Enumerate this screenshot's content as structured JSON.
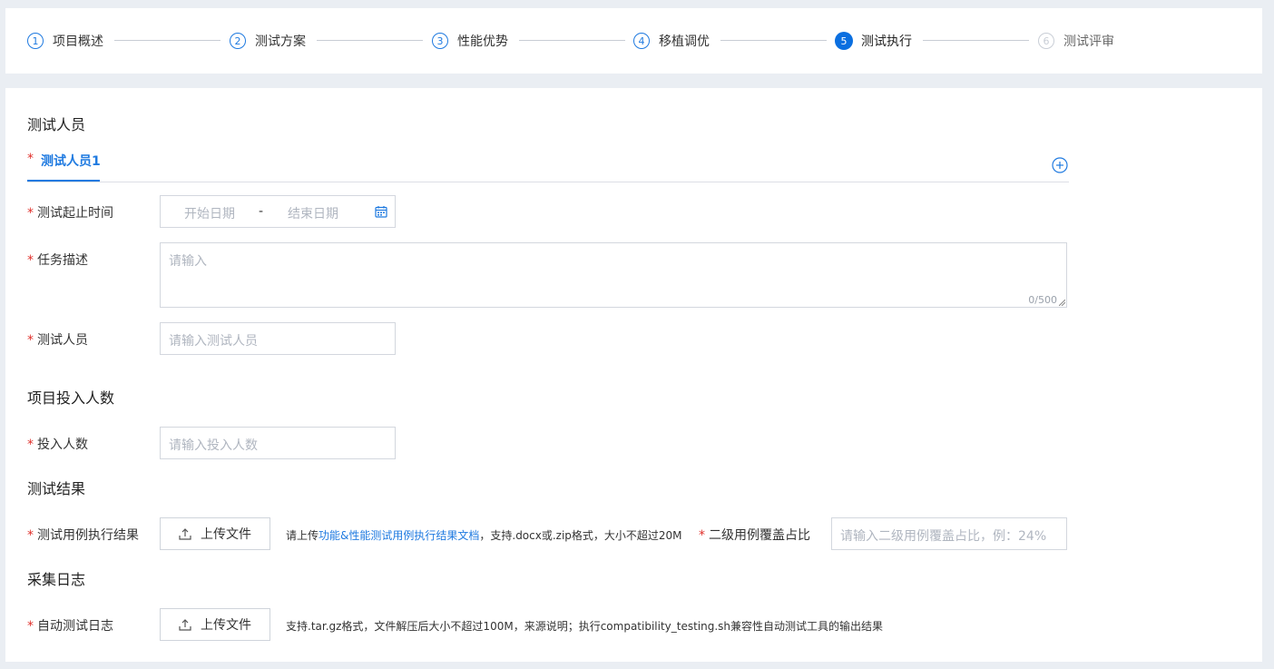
{
  "steps": [
    {
      "num": "1",
      "label": "项目概述",
      "state": "done"
    },
    {
      "num": "2",
      "label": "测试方案",
      "state": "done"
    },
    {
      "num": "3",
      "label": "性能优势",
      "state": "done"
    },
    {
      "num": "4",
      "label": "移植调优",
      "state": "done"
    },
    {
      "num": "5",
      "label": "测试执行",
      "state": "active"
    },
    {
      "num": "6",
      "label": "测试评审",
      "state": "pending"
    }
  ],
  "testers_section": {
    "title": "测试人员",
    "tab_label": "测试人员1",
    "add_icon": "plus-circle-icon",
    "period": {
      "label": "测试起止时间",
      "start_placeholder": "开始日期",
      "separator": "-",
      "end_placeholder": "结束日期",
      "icon": "calendar-icon"
    },
    "task": {
      "label": "任务描述",
      "placeholder": "请输入",
      "counter": "0/500"
    },
    "tester": {
      "label": "测试人员",
      "placeholder": "请输入测试人员"
    }
  },
  "investment_section": {
    "title": "项目投入人数",
    "label": "投入人数",
    "placeholder": "请输入投入人数"
  },
  "results_section": {
    "title": "测试结果",
    "label": "测试用例执行结果",
    "upload_label": "上传文件",
    "hint_prefix": "请上传",
    "hint_link": "功能&性能测试用例执行结果文档",
    "hint_suffix": "，支持.docx或.zip格式，大小不超过20M",
    "coverage_label": "二级用例覆盖占比",
    "coverage_placeholder": "请输入二级用例覆盖占比，例：24%"
  },
  "logs_section": {
    "title": "采集日志",
    "label": "自动测试日志",
    "upload_label": "上传文件",
    "hint": "支持.tar.gz格式，文件解压后大小不超过100M，来源说明；执行compatibility_testing.sh兼容性自动测试工具的输出结果"
  },
  "colors": {
    "primary": "#1f7ae0",
    "required": "#e0302b",
    "background": "#eaeef3"
  }
}
